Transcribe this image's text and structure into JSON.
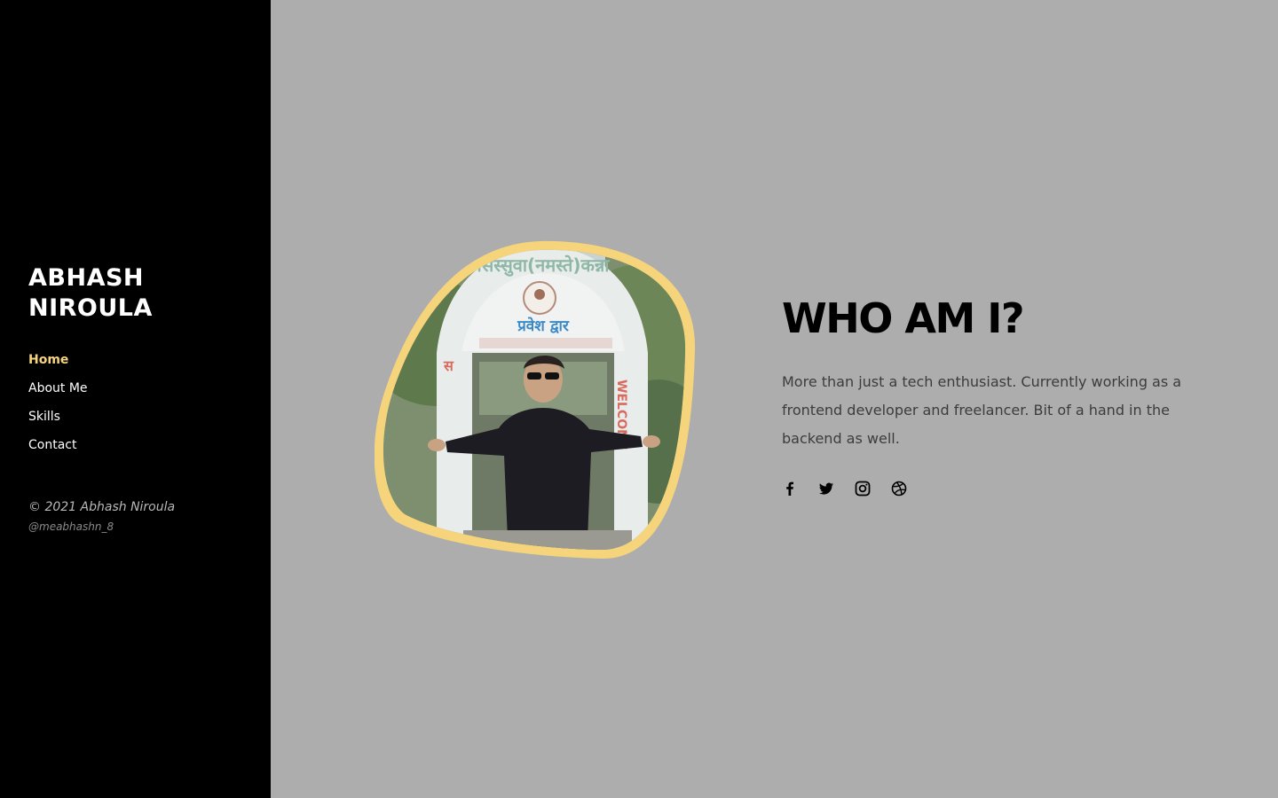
{
  "sidebar": {
    "brand_line1": "ABHASH",
    "brand_line2": "NIROULA",
    "nav": [
      {
        "label": "Home",
        "active": true
      },
      {
        "label": "About Me",
        "active": false
      },
      {
        "label": "Skills",
        "active": false
      },
      {
        "label": "Contact",
        "active": false
      }
    ],
    "copyright": "© 2021 Abhash Niroula",
    "handle": "@meabhashn_8"
  },
  "hero": {
    "title": "WHO AM I?",
    "description": "More than just a tech enthusiast. Currently working as a frontend developer and freelancer. Bit of a hand in the backend as well.",
    "photo_sign_top": "सिस्सुवा(नमस्ते)कन्ना",
    "photo_sign_main": "प्रवेश द्वार",
    "photo_sign_right": "WELCOME",
    "socials": [
      {
        "icon": "facebook-icon"
      },
      {
        "icon": "twitter-icon"
      },
      {
        "icon": "instagram-icon"
      },
      {
        "icon": "dribbble-icon"
      }
    ]
  },
  "colors": {
    "sidebar_bg": "#000000",
    "main_bg": "#adadad",
    "accent": "#f6d47c",
    "title": "#000000",
    "text": "#3c3c3c"
  }
}
